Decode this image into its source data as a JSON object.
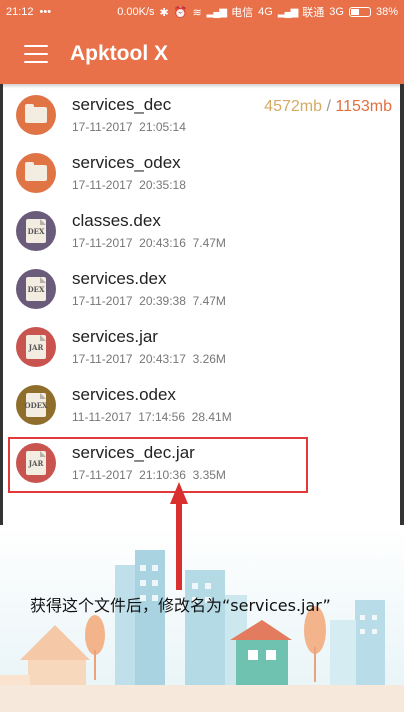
{
  "status_bar": {
    "time": "21:12",
    "dots": "•••",
    "speed": "0.00K/s",
    "carrier1": "电信",
    "net1": "4G",
    "carrier2": "联通",
    "net2": "3G",
    "battery": "38%"
  },
  "app_bar": {
    "title": "Apktool X"
  },
  "storage": {
    "free": "4572mb",
    "separator": "/",
    "total": "1153mb"
  },
  "files": [
    {
      "name": "services_dec",
      "date": "17-11-2017",
      "time": "21:05:14",
      "size": "",
      "type": "folder"
    },
    {
      "name": "services_odex",
      "date": "17-11-2017",
      "time": "20:35:18",
      "size": "",
      "type": "folder"
    },
    {
      "name": "classes.dex",
      "date": "17-11-2017",
      "time": "20:43:16",
      "size": "7.47M",
      "type": "dex"
    },
    {
      "name": "services.dex",
      "date": "17-11-2017",
      "time": "20:39:38",
      "size": "7.47M",
      "type": "dex"
    },
    {
      "name": "services.jar",
      "date": "17-11-2017",
      "time": "20:43:17",
      "size": "3.26M",
      "type": "jar"
    },
    {
      "name": "services.odex",
      "date": "11-11-2017",
      "time": "17:14:56",
      "size": "28.41M",
      "type": "odex"
    },
    {
      "name": "services_dec.jar",
      "date": "17-11-2017",
      "time": "21:10:36",
      "size": "3.35M",
      "type": "jar"
    }
  ],
  "icon_tags": {
    "dex": "DEX",
    "jar": "JAR",
    "odex": "ODEX"
  },
  "annotation": {
    "caption": "获得这个文件后，修改名为“services.jar”"
  },
  "colors": {
    "accent": "#e8714a",
    "highlight": "#e23a3a",
    "arrow": "#d92f2f"
  }
}
